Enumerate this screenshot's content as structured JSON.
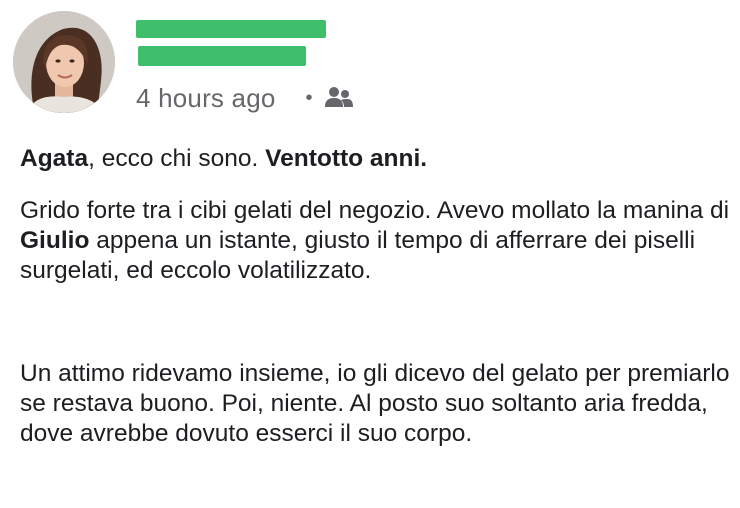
{
  "post": {
    "timestamp": "4 hours ago",
    "separator": "•",
    "audience_icon": "friends-icon",
    "redaction_color": "#3fbf6b",
    "headline": {
      "name": "Agata",
      "middle": ", ecco chi sono. ",
      "age": "Ventotto anni."
    },
    "paragraph1": {
      "part1": "Grido forte tra i cibi gelati del negozio. Avevo mollato la manina di ",
      "name": "Giulio",
      "part2": " appena un istante, giusto il tempo di afferrare dei piselli surgelati, ed eccolo volatilizzato."
    },
    "paragraph2": "Un attimo ridevamo insieme, io gli dicevo del gelato per premiarlo se restava buono. Poi, niente. Al posto suo soltanto aria fredda, dove avrebbe dovuto esserci il suo corpo."
  }
}
